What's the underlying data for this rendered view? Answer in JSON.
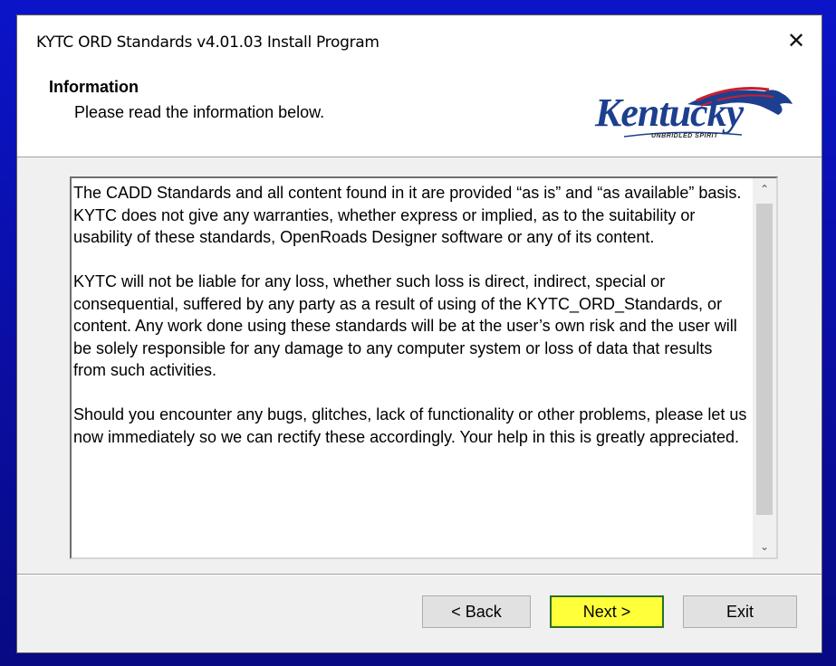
{
  "window": {
    "title": "KYTC ORD Standards v4.01.03 Install Program",
    "close_glyph": "✕"
  },
  "header": {
    "heading": "Information",
    "subheading": "Please read the information below.",
    "logo": {
      "word": "Kentucky",
      "tagline": "UNBRIDLED SPIRIT",
      "icon": "horse-head-logo"
    }
  },
  "info_text": {
    "paragraphs": [
      "The CADD Standards and all content found in it are provided “as is” and “as available” basis.  KYTC does not give any warranties, whether express or implied, as to the suitability or usability of these standards, OpenRoads Designer software or any of its content.",
      "KYTC will not be liable for any loss, whether such loss is direct, indirect, special or consequential, suffered by any party as a result of using of the KYTC_ORD_Standards, or content. Any work done using these standards will be at the user’s own risk and the user will be solely responsible for any damage to any computer system or loss of data that results from such activities.",
      "Should you encounter any bugs, glitches, lack of functionality or other problems, please let us now immediately so we can rectify these accordingly. Your help in this is greatly appreciated."
    ]
  },
  "scrollbar": {
    "up_glyph": "⌃",
    "down_glyph": "⌄"
  },
  "buttons": {
    "back": "< Back",
    "next": "Next >",
    "exit": "Exit"
  },
  "colors": {
    "next_highlight": "#ffff3a",
    "desktop_blue": "#0b14c8"
  }
}
